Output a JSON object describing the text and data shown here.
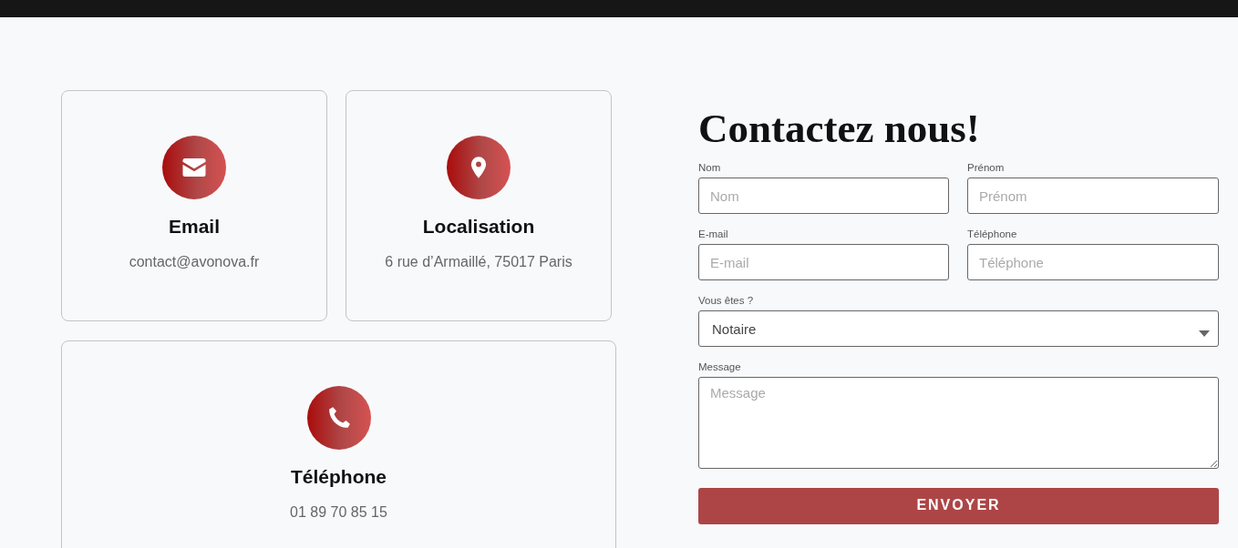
{
  "cards": [
    {
      "kind": "email",
      "title": "Email",
      "text": "contact@avonova.fr"
    },
    {
      "kind": "location",
      "title": "Localisation",
      "text": "6 rue d’Armaillé, 75017 Paris"
    },
    {
      "kind": "phone",
      "title": "Téléphone",
      "text": "01 89 70 85 15"
    }
  ],
  "form": {
    "title": "Contactez nous!",
    "fields": [
      {
        "kind": "input",
        "label": "Nom",
        "placeholder": "Nom"
      },
      {
        "kind": "input",
        "label": "Prénom",
        "placeholder": "Prénom"
      },
      {
        "kind": "input",
        "label": "E-mail",
        "placeholder": "E-mail"
      },
      {
        "kind": "input",
        "label": "Téléphone",
        "placeholder": "Téléphone"
      },
      {
        "kind": "select",
        "label": "Vous êtes ?",
        "value": "Notaire"
      },
      {
        "kind": "textarea",
        "label": "Message",
        "placeholder": "Message"
      }
    ],
    "button": "ENVOYER"
  }
}
